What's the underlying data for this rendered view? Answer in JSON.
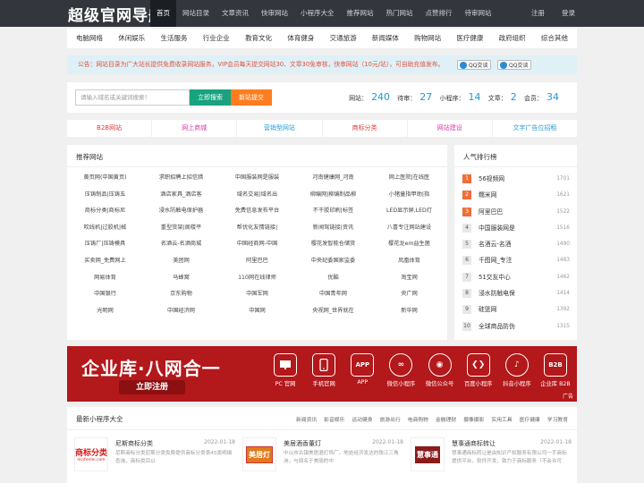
{
  "site": {
    "logo": "超级官网导航"
  },
  "topnav": [
    {
      "label": "首页",
      "active": true
    },
    {
      "label": "网站目录"
    },
    {
      "label": "文章资讯"
    },
    {
      "label": "快审网站"
    },
    {
      "label": "小程序大全"
    },
    {
      "label": "推荐网站"
    },
    {
      "label": "热门网站"
    },
    {
      "label": "点赞排行"
    },
    {
      "label": "待审网站"
    }
  ],
  "user": {
    "register": "注册",
    "login": "登录"
  },
  "categories": [
    "电脑网络",
    "休闲娱乐",
    "生活服务",
    "行业企业",
    "教育文化",
    "体育健身",
    "交通旅游",
    "新闻媒体",
    "购物网站",
    "医疗健康",
    "政府组织",
    "综合其他"
  ],
  "notice": {
    "text": "公告：网站目录为广大站长提供免费收录网站服务，VIP会员每天提交网站30、文章30免审核，快审网站（10元/站），可自助充值发布。",
    "qq1": "QQ交谈",
    "qq2": "QQ交谈"
  },
  "search": {
    "placeholder": "请输入域名或关键词搜索！",
    "search_btn": "立即搜索",
    "submit_btn": "新站提交"
  },
  "stats": [
    {
      "label": "网站：",
      "value": "240"
    },
    {
      "label": "待审：",
      "value": "27"
    },
    {
      "label": "小程序：",
      "value": "14"
    },
    {
      "label": "文章：",
      "value": "2"
    },
    {
      "label": "会员：",
      "value": "34"
    }
  ],
  "tabs": [
    {
      "label": "B2B网站",
      "color": "#e03b3b"
    },
    {
      "label": "网上商城",
      "color": "#d93aa8"
    },
    {
      "label": "营销型网站",
      "color": "#2a9bd6"
    },
    {
      "label": "商标分类",
      "color": "#e03b3b"
    },
    {
      "label": "网站建设",
      "color": "#d93aa8"
    },
    {
      "label": "文字广告位招租",
      "color": "#2a9bd6"
    }
  ],
  "recommend": {
    "title": "推荐网站",
    "sites": [
      "黄页网(中国黄页)",
      "求职招聘上招信猎",
      "中国服装网是服装",
      "河南健康网_河南",
      "网上医院|在线医",
      "压铸制品|压铸五",
      "酒店家具_酒店客",
      "域名交易|域名出",
      "柳编网|柳编制品柳",
      "小猪童指甲助|指",
      "商标分类|商标尼",
      "浸水防触电保护器",
      "免费信息发布平台",
      "不干胶印刷|标签",
      "LED显示屏,LED灯",
      "吹线机|过胶机|械",
      "重型货架|阁楼平",
      "帮优化友情链接|",
      "新闻驾链接|资讯",
      "八喜专注网站建设",
      "压铸厂|压铸模具",
      "名酒云-名酒商城",
      "中国经商网-中国",
      "樱花发智能仓储货",
      "樱花龙em益生菌",
      "买卖网_免费网上",
      "美团网",
      "阿里巴巴",
      "中央纪委国家监委",
      "凤凰体育",
      "网易体育",
      "马蜂窝",
      "110网在线律师",
      "优酷",
      "淘宝网",
      "中国银行",
      "京东购物",
      "中国军网",
      "中国青年网",
      "央广网",
      "光明网",
      "中国经济网",
      "中国网",
      "央视网_世界就在",
      "新华网"
    ]
  },
  "rank": {
    "title": "人气排行榜",
    "items": [
      {
        "n": "1",
        "name": "56视频网",
        "count": "1701"
      },
      {
        "n": "2",
        "name": "糯米网",
        "count": "1621"
      },
      {
        "n": "3",
        "name": "阿里巴巴",
        "count": "1522"
      },
      {
        "n": "4",
        "name": "中国服装网是",
        "count": "1516"
      },
      {
        "n": "5",
        "name": "名酒云-名酒",
        "count": "1490"
      },
      {
        "n": "6",
        "name": "千图网_专注",
        "count": "1483"
      },
      {
        "n": "7",
        "name": "51交友中心",
        "count": "1462"
      },
      {
        "n": "8",
        "name": "浸水防触电保",
        "count": "1414"
      },
      {
        "n": "9",
        "name": "硅篮网",
        "count": "1392"
      },
      {
        "n": "10",
        "name": "全球商品防伪",
        "count": "1315"
      }
    ]
  },
  "banner": {
    "title": "企业库·八网合一",
    "cta": "立即注册",
    "items": [
      "PC 官网",
      "手机官网",
      "APP",
      "微信小程序",
      "微信公众号",
      "百度小程序",
      "抖音小程序",
      "企业库 B2B"
    ],
    "ad": "广告"
  },
  "mini": {
    "title": "最新小程序大全",
    "tabs": [
      "新闻资讯",
      "影音娱乐",
      "运动健身",
      "旅游出行",
      "电商购物",
      "金融理财",
      "摄像摄影",
      "实用工具",
      "医疗健康",
      "学习教育"
    ],
    "apps": [
      {
        "name": "尼斯商标分类",
        "date": "2022-01-18",
        "desc": "尼斯商标分类尼斯分类免费提供商标分类表45类明细查询，商标类目以",
        "thumb": "商标分类",
        "thumb_sub": "nicifenlei.com"
      },
      {
        "name": "美居酒香董灯",
        "date": "2022-01-18",
        "desc": "中山市古镇美居酒灯饰厂，地处经济发达的珠江三角洲，与闻名于美丽的中",
        "thumb": "美居灯"
      },
      {
        "name": "慧事通商标转让",
        "date": "2022-01-18",
        "desc": "慧事通商标转让是由知识产权服务有限公司一手商标提供平台，软件开发，致力于商标服务（不会许可",
        "thumb": "慧事通"
      }
    ]
  }
}
